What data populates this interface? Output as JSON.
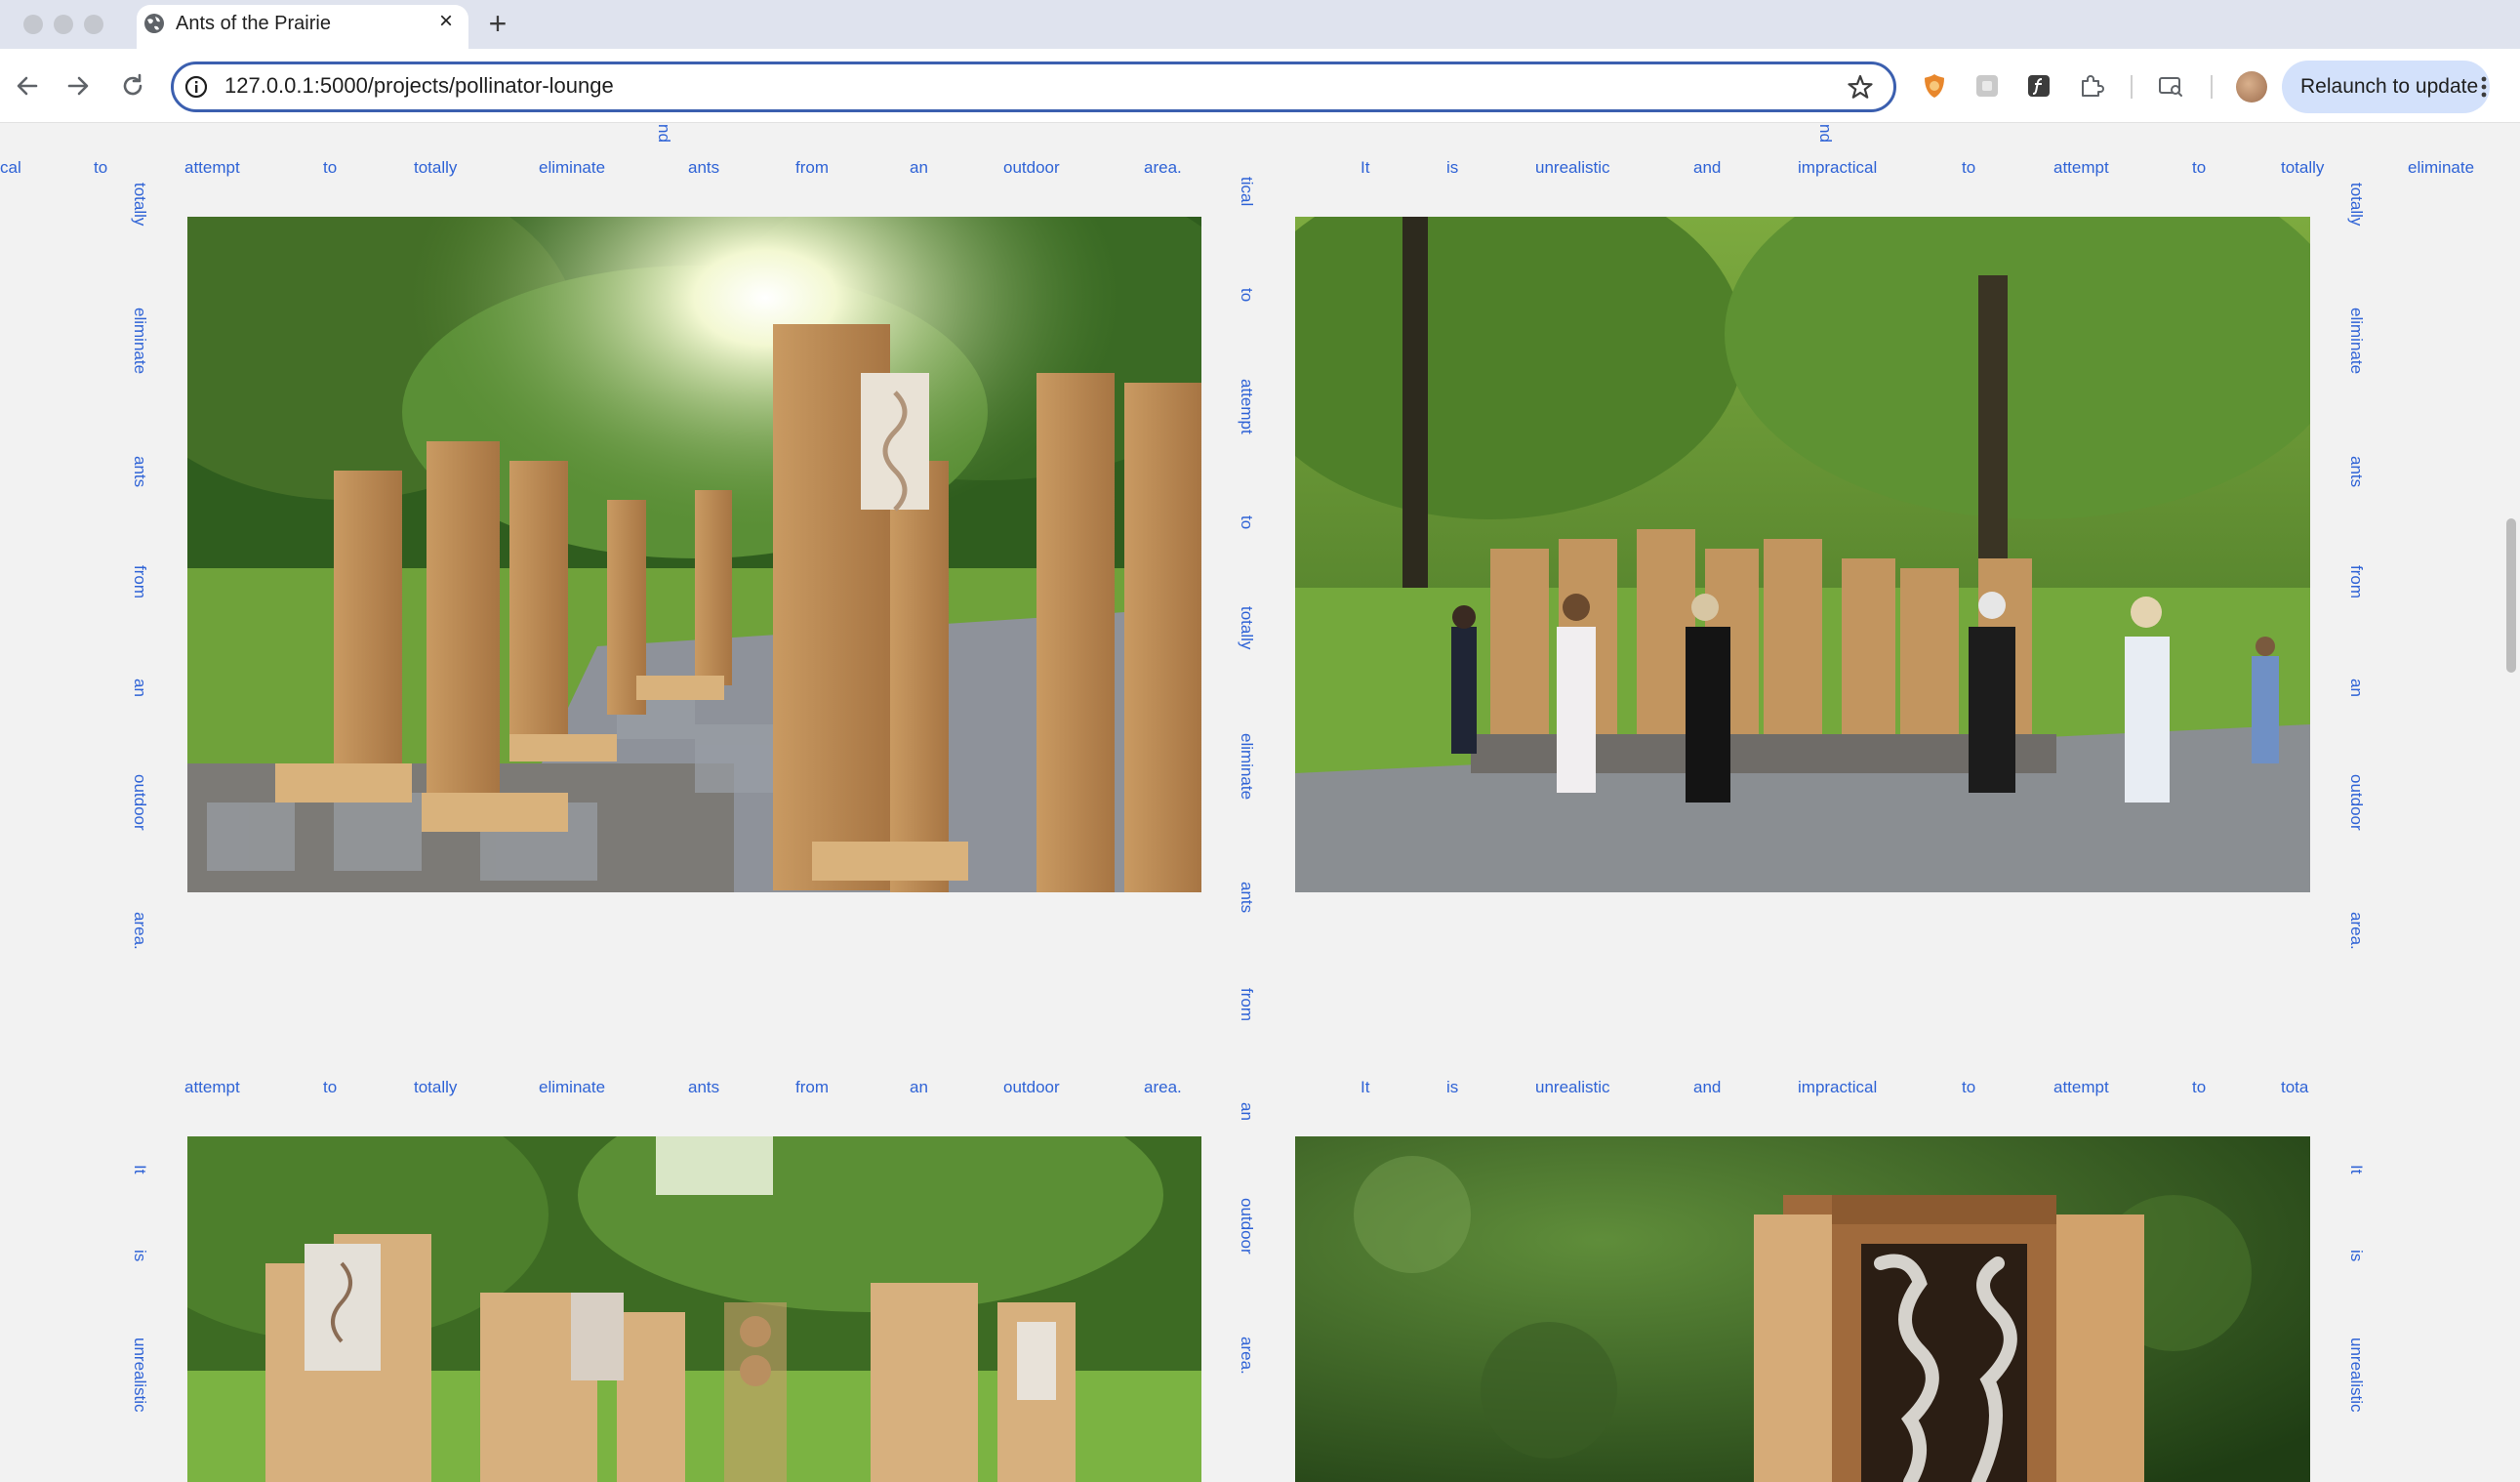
{
  "browser": {
    "tab_title": "Ants of the Prairie",
    "tab_close": "×",
    "new_tab": "+",
    "url": "127.0.0.1:5000/projects/pollinator-lounge",
    "relaunch_label": "Relaunch to update"
  },
  "page": {
    "ribbon_top_left": [
      "cal",
      "to",
      "attempt",
      "to",
      "totally",
      "eliminate",
      "ants",
      "from",
      "an",
      "outdoor",
      "area."
    ],
    "ribbon_top_right": [
      "It",
      "is",
      "unrealistic",
      "and",
      "impractical",
      "to",
      "attempt",
      "to",
      "totally",
      "eliminate"
    ],
    "ribbon_mid_left": [
      "attempt",
      "to",
      "totally",
      "eliminate",
      "ants",
      "from",
      "an",
      "outdoor",
      "area."
    ],
    "ribbon_mid_right": [
      "It",
      "is",
      "unrealistic",
      "and",
      "impractical",
      "to",
      "attempt",
      "to",
      "tota"
    ],
    "col_left_upper": [
      "totally",
      "eliminate",
      "ants",
      "from",
      "an",
      "outdoor",
      "area."
    ],
    "col_left_lower": [
      "It",
      "is",
      "unrealistic"
    ],
    "col_center": [
      "tical",
      "to",
      "attempt",
      "to",
      "totally",
      "eliminate",
      "ants",
      "from",
      "an",
      "outdoor",
      "area."
    ],
    "col_right_upper": [
      "totally",
      "eliminate",
      "ants",
      "from",
      "an",
      "outdoor",
      "area."
    ],
    "col_right_lower": [
      "It",
      "is",
      "unrealistic"
    ],
    "stub_left": "nd",
    "stub_right": "nd",
    "photos": [
      "sunlit garden installation of tall cedar pollinator posts on stone gabion benches",
      "visitors walking among cedar pollinator posts along a garden path",
      "cedar pollinator posts with carved bee panels under green trees",
      "close-up of a cedar pollinator box with carved nest cavities"
    ]
  }
}
